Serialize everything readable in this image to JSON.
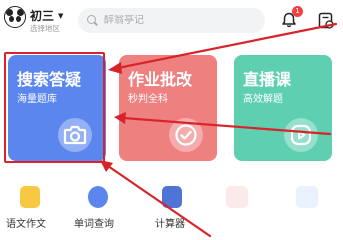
{
  "header": {
    "grade": "初三",
    "region": "选择地区",
    "search_placeholder": "醉翁亭记",
    "notification_count": "1"
  },
  "cards": [
    {
      "title": "搜索答疑",
      "subtitle": "海量题库",
      "icon": "camera-icon",
      "color": "#5a86ee"
    },
    {
      "title": "作业批改",
      "subtitle": "秒判全科",
      "icon": "check-icon",
      "color": "#ee8080"
    },
    {
      "title": "直播课",
      "subtitle": "高效解题",
      "icon": "play-icon",
      "color": "#5fcfb2"
    }
  ],
  "tools": [
    {
      "label": "语文作文",
      "color": "#f6c843"
    },
    {
      "label": "单词查询",
      "color": "#5a86ee"
    },
    {
      "label": "计算器",
      "color": "#4e74d6"
    }
  ],
  "annotation_color": "#d8232a"
}
